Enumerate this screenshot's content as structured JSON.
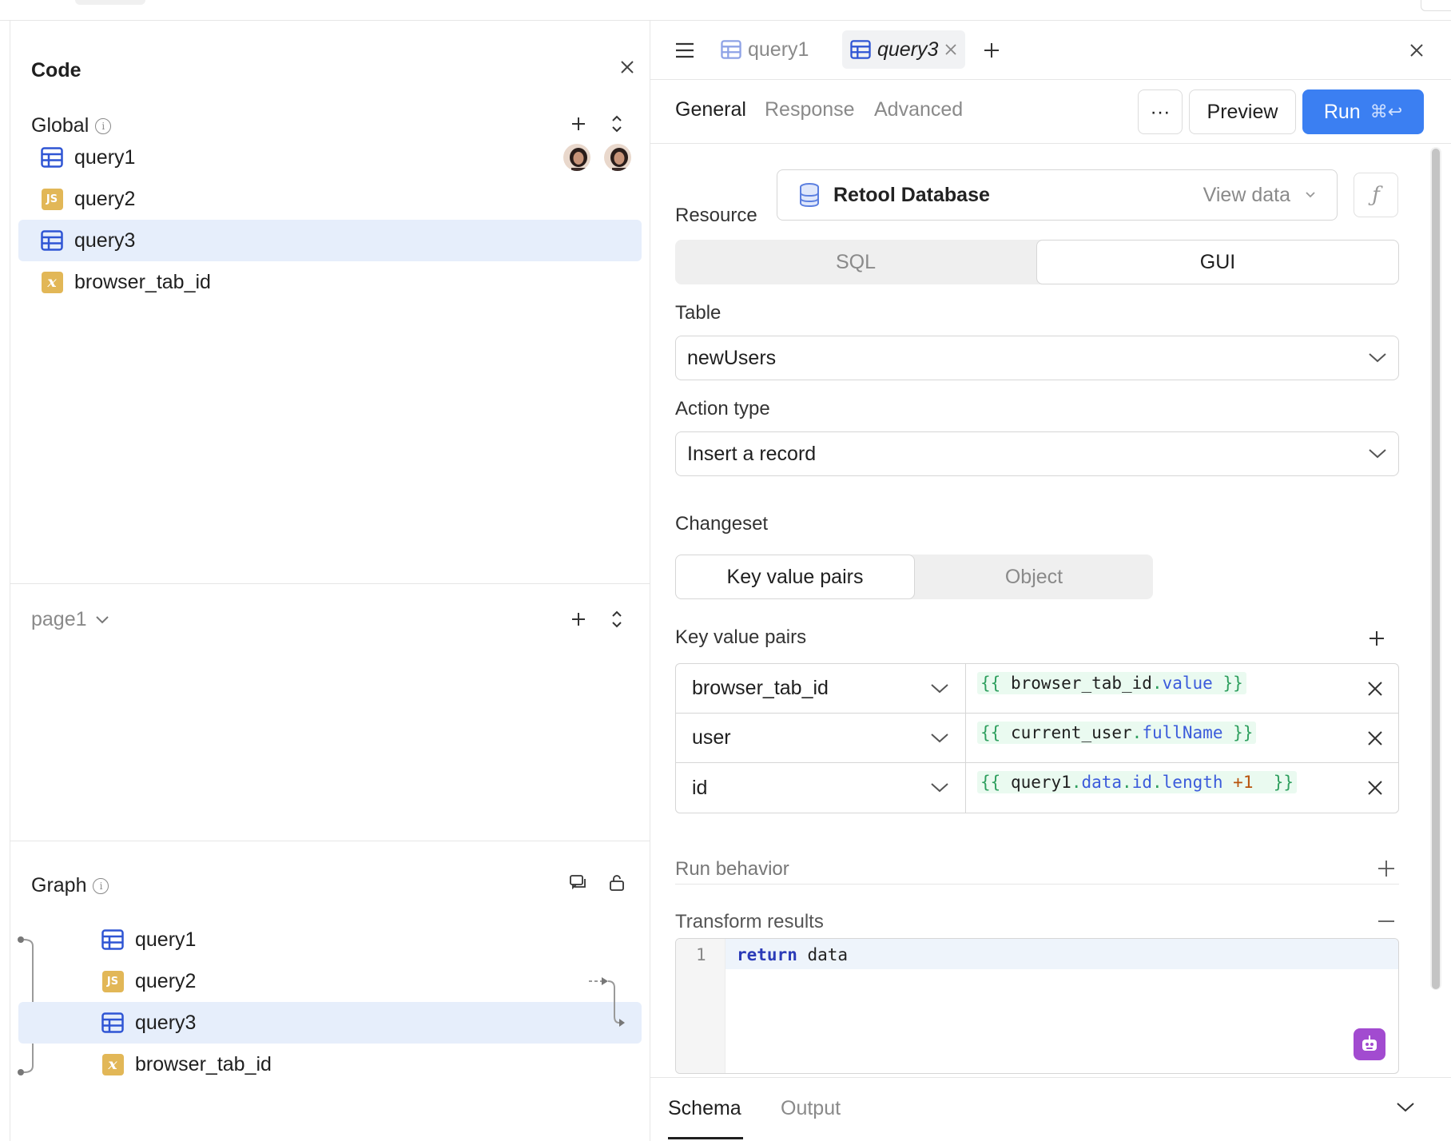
{
  "code_panel": {
    "title": "Code",
    "global": {
      "title": "Global",
      "items": [
        {
          "label": "query1",
          "icon": "table-query-icon"
        },
        {
          "label": "query2",
          "icon": "js-query-icon"
        },
        {
          "label": "query3",
          "icon": "table-query-icon",
          "selected": true
        },
        {
          "label": "browser_tab_id",
          "icon": "variable-icon"
        }
      ]
    },
    "page": {
      "label": "page1"
    },
    "graph": {
      "title": "Graph",
      "items": [
        {
          "label": "query1"
        },
        {
          "label": "query2"
        },
        {
          "label": "query3",
          "selected": true
        },
        {
          "label": "browser_tab_id"
        }
      ]
    }
  },
  "editor_panel": {
    "tabs": [
      {
        "label": "query1",
        "active": false
      },
      {
        "label": "query3",
        "active": true
      }
    ],
    "subtabs": [
      "General",
      "Response",
      "Advanced"
    ],
    "buttons": {
      "more": "···",
      "preview": "Preview",
      "run": "Run",
      "run_shortcut": "⌘↩"
    },
    "resource": {
      "label": "Resource",
      "name": "Retool Database",
      "view": "View data"
    },
    "mode": {
      "options": [
        "SQL",
        "GUI"
      ],
      "selected": "GUI"
    },
    "table": {
      "label": "Table",
      "value": "newUsers"
    },
    "action_type": {
      "label": "Action type",
      "value": "Insert a record"
    },
    "changeset": {
      "label": "Changeset",
      "options": [
        "Key value pairs",
        "Object"
      ],
      "selected": "Key value pairs"
    },
    "kv": {
      "label": "Key value pairs",
      "rows": [
        {
          "key": "browser_tab_id",
          "value": "{{ browser_tab_id.value }}"
        },
        {
          "key": "user",
          "value": "{{ current_user.fullName }}"
        },
        {
          "key": "id",
          "value": "{{ query1.data.id.length +1  }}"
        }
      ]
    },
    "run_behavior": {
      "label": "Run behavior"
    },
    "transform": {
      "label": "Transform results",
      "line_number": "1",
      "code_keyword": "return",
      "code_rest": " data"
    },
    "bottom_tabs": [
      "Schema",
      "Output"
    ]
  },
  "colors": {
    "accent": "#3b7ff2",
    "selected_bg": "#e6eefb",
    "js_badge": "#e2b757",
    "query_icon": "#2f55d4"
  }
}
